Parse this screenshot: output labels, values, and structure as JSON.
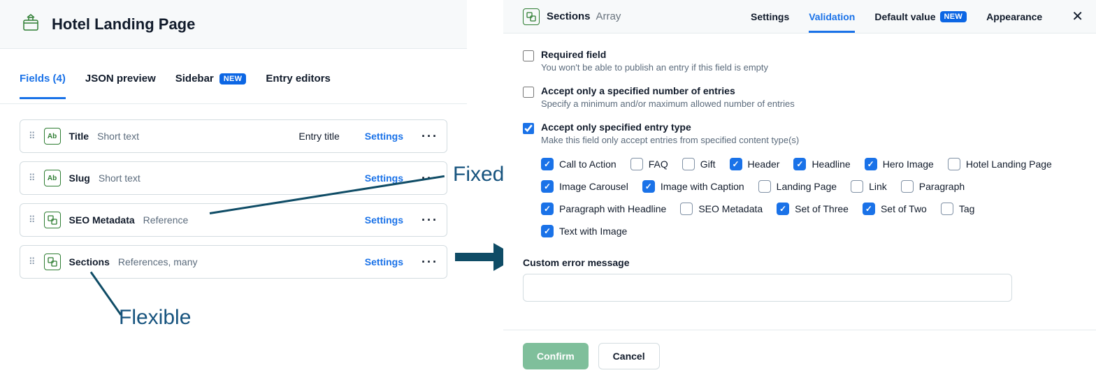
{
  "header": {
    "title": "Hotel Landing Page",
    "icon": "package-icon"
  },
  "tabs": {
    "active": 0,
    "items": [
      {
        "label": "Fields (4)"
      },
      {
        "label": "JSON preview"
      },
      {
        "label": "Sidebar",
        "badge": "NEW"
      },
      {
        "label": "Entry editors"
      }
    ]
  },
  "fields": [
    {
      "name": "Title",
      "type": "Short text",
      "icon": "Ab",
      "entry_title": "Entry title",
      "settings": "Settings"
    },
    {
      "name": "Slug",
      "type": "Short text",
      "icon": "Ab",
      "settings": "Settings"
    },
    {
      "name": "SEO Metadata",
      "type": "Reference",
      "icon": "ref",
      "settings": "Settings"
    },
    {
      "name": "Sections",
      "type": "References, many",
      "icon": "ref",
      "settings": "Settings"
    }
  ],
  "annotations": {
    "fixed_label": "Fixed",
    "flexible_label": "Flexible"
  },
  "right": {
    "header": {
      "title": "Sections",
      "type": "Array"
    },
    "tabs": {
      "active": 1,
      "items": [
        {
          "label": "Settings"
        },
        {
          "label": "Validation"
        },
        {
          "label": "Default value",
          "badge": "NEW"
        },
        {
          "label": "Appearance"
        }
      ]
    },
    "validation_options": [
      {
        "checked": false,
        "label": "Required field",
        "desc": "You won't be able to publish an entry if this field is empty"
      },
      {
        "checked": false,
        "label": "Accept only a specified number of entries",
        "desc": "Specify a minimum and/or maximum allowed number of entries"
      },
      {
        "checked": true,
        "label": "Accept only specified entry type",
        "desc": "Make this field only accept entries from specified content type(s)"
      }
    ],
    "entry_types": [
      {
        "label": "Call to Action",
        "checked": true
      },
      {
        "label": "FAQ",
        "checked": false
      },
      {
        "label": "Gift",
        "checked": false
      },
      {
        "label": "Header",
        "checked": true
      },
      {
        "label": "Headline",
        "checked": true
      },
      {
        "label": "Hero Image",
        "checked": true
      },
      {
        "label": "Hotel Landing Page",
        "checked": false
      },
      {
        "label": "Image Carousel",
        "checked": true
      },
      {
        "label": "Image with Caption",
        "checked": true
      },
      {
        "label": "Landing Page",
        "checked": false
      },
      {
        "label": "Link",
        "checked": false
      },
      {
        "label": "Paragraph",
        "checked": false
      },
      {
        "label": "Paragraph with Headline",
        "checked": true
      },
      {
        "label": "SEO Metadata",
        "checked": false
      },
      {
        "label": "Set of Three",
        "checked": true
      },
      {
        "label": "Set of Two",
        "checked": true
      },
      {
        "label": "Tag",
        "checked": false
      },
      {
        "label": "Text with Image",
        "checked": true
      }
    ],
    "custom_error": {
      "label": "Custom error message",
      "value": ""
    },
    "buttons": {
      "confirm": "Confirm",
      "cancel": "Cancel"
    }
  },
  "colors": {
    "accent": "#1a72e8",
    "confirm": "#7fbf9b",
    "annotation": "#0f4c66"
  }
}
